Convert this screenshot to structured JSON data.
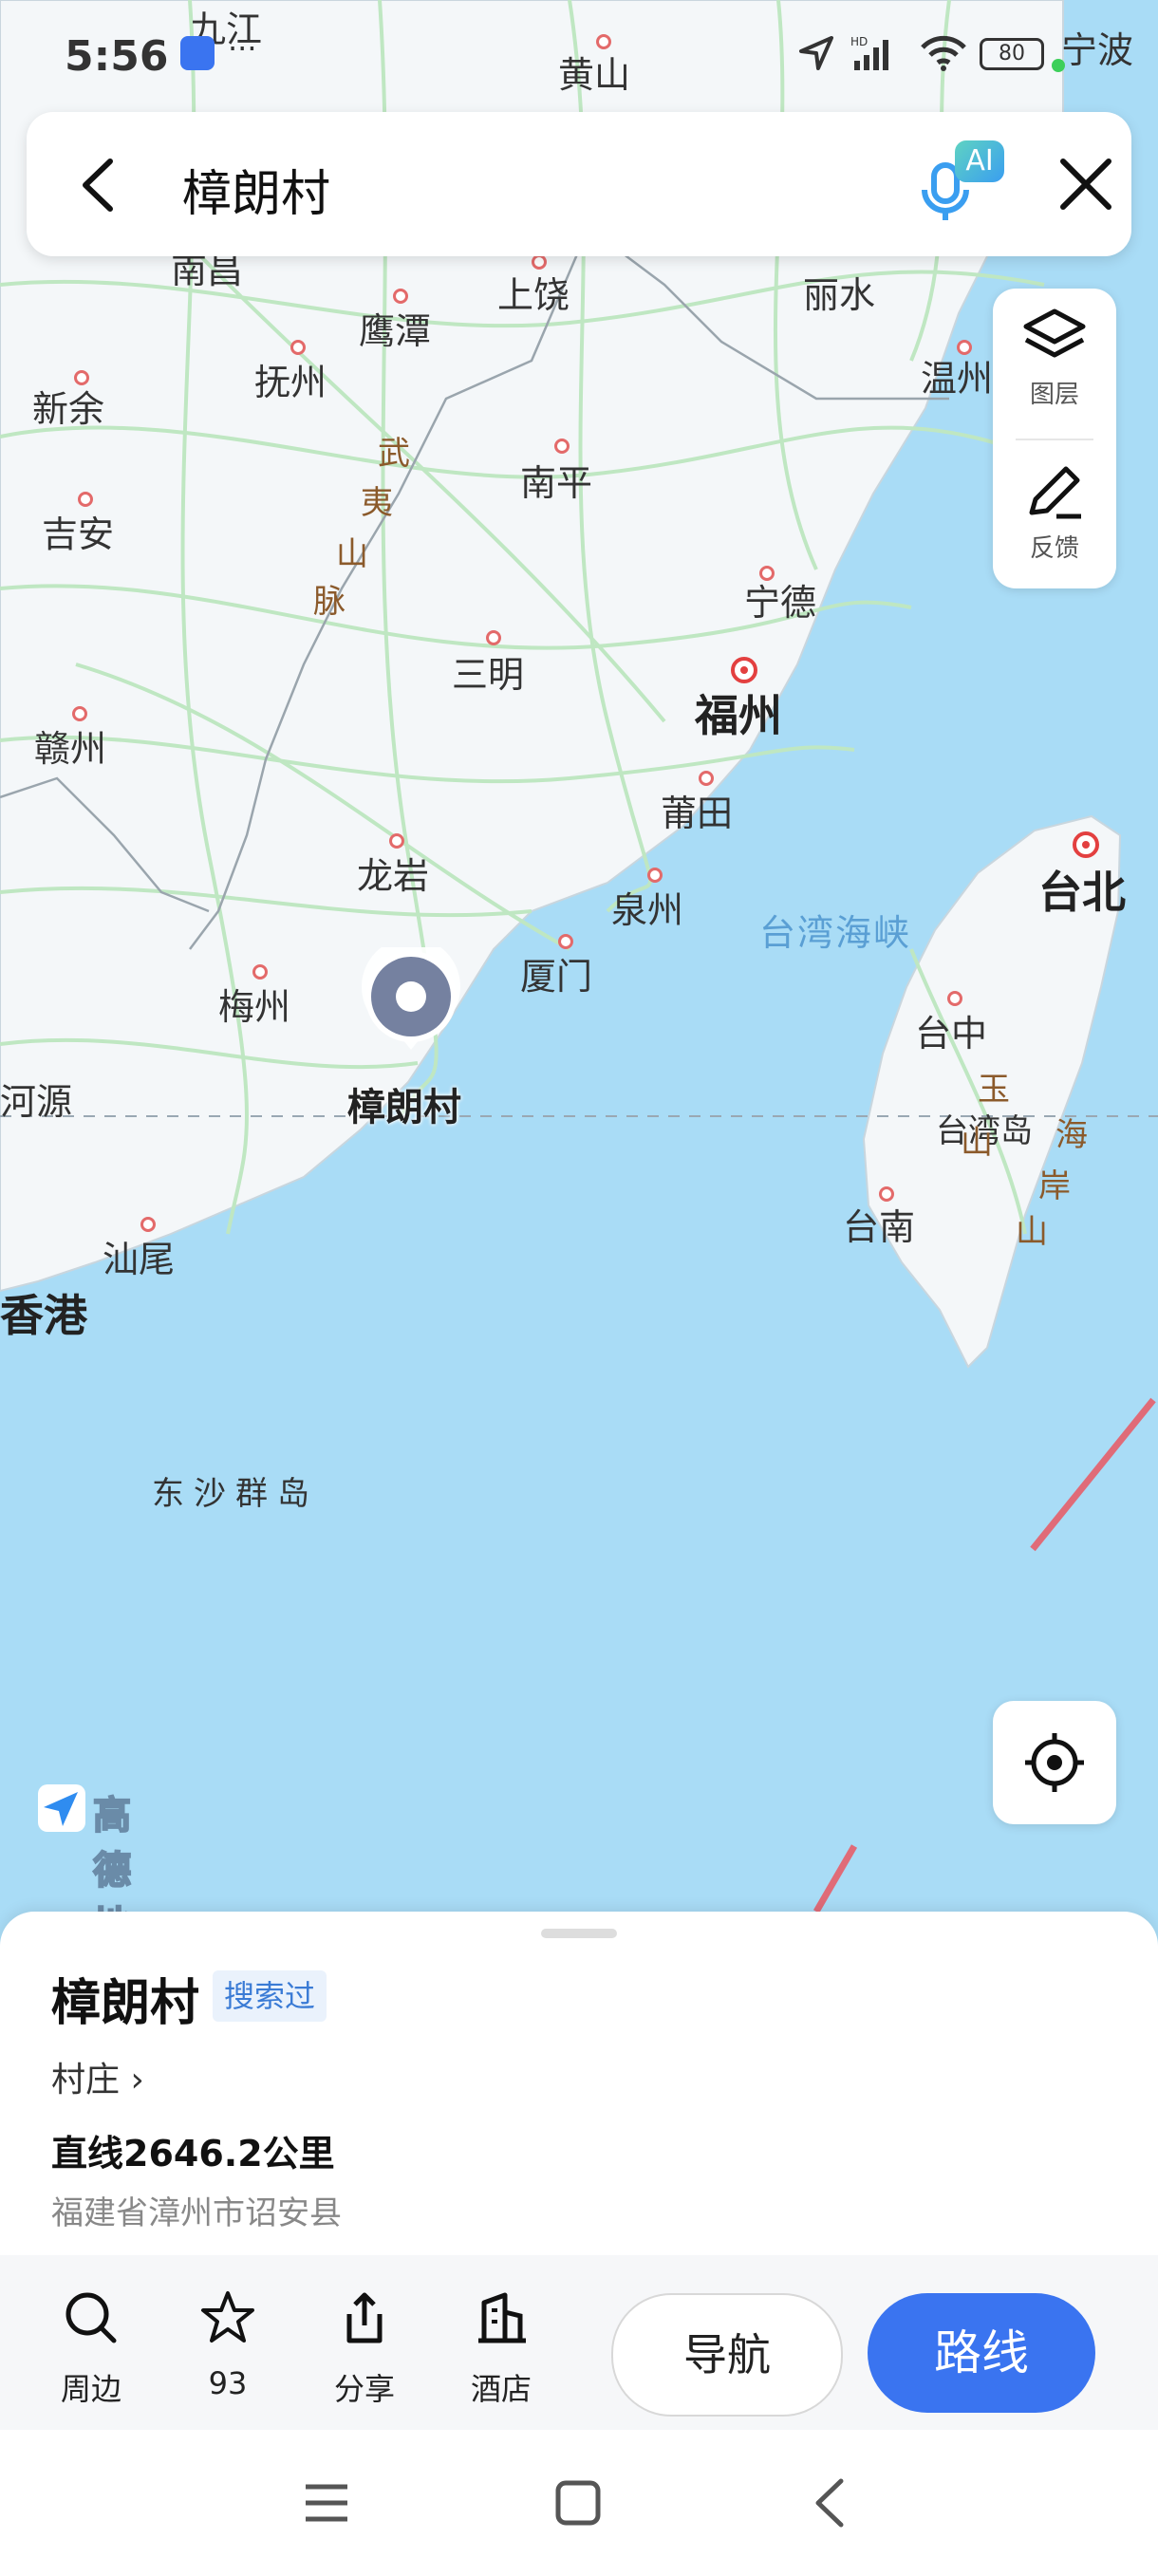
{
  "status_bar": {
    "time": "5:56",
    "battery": "80",
    "extra": "···"
  },
  "search": {
    "query": "樟朗村",
    "ai_badge": "AI"
  },
  "tools": {
    "layers_label": "图层",
    "feedback_label": "反馈"
  },
  "brand": "高德地图",
  "map": {
    "cities_small": [
      "九江",
      "黄山",
      "宁波",
      "南昌",
      "上饶",
      "丽水",
      "鹰潭",
      "抚州",
      "温州",
      "新余",
      "南平",
      "吉安",
      "宁德",
      "三明",
      "赣州",
      "莆田",
      "龙岩",
      "泉州",
      "厦门",
      "梅州",
      "河源",
      "汕尾",
      "台中",
      "台湾岛",
      "台南"
    ],
    "cities_big": [
      "福州",
      "台北",
      "香港"
    ],
    "sea": [
      "台湾海峡",
      "东沙群岛"
    ],
    "ranges": [
      "武",
      "夷",
      "山",
      "脉",
      "玉",
      "山",
      "海",
      "岸",
      "山"
    ]
  },
  "pin": {
    "label": "樟朗村"
  },
  "sheet": {
    "title": "樟朗村",
    "tag": "搜索过",
    "category": "村庄 ›",
    "distance": "直线2646.2公里",
    "address": "福建省漳州市诏安县"
  },
  "actions": {
    "nearby": "周边",
    "favorites": "93",
    "share": "分享",
    "hotel": "酒店",
    "navigate": "导航",
    "route": "路线"
  },
  "colors": {
    "sea": "#a9dcf6",
    "land": "#f4f7f9",
    "road": "#bfe7c2",
    "accent": "#3a74f0"
  }
}
